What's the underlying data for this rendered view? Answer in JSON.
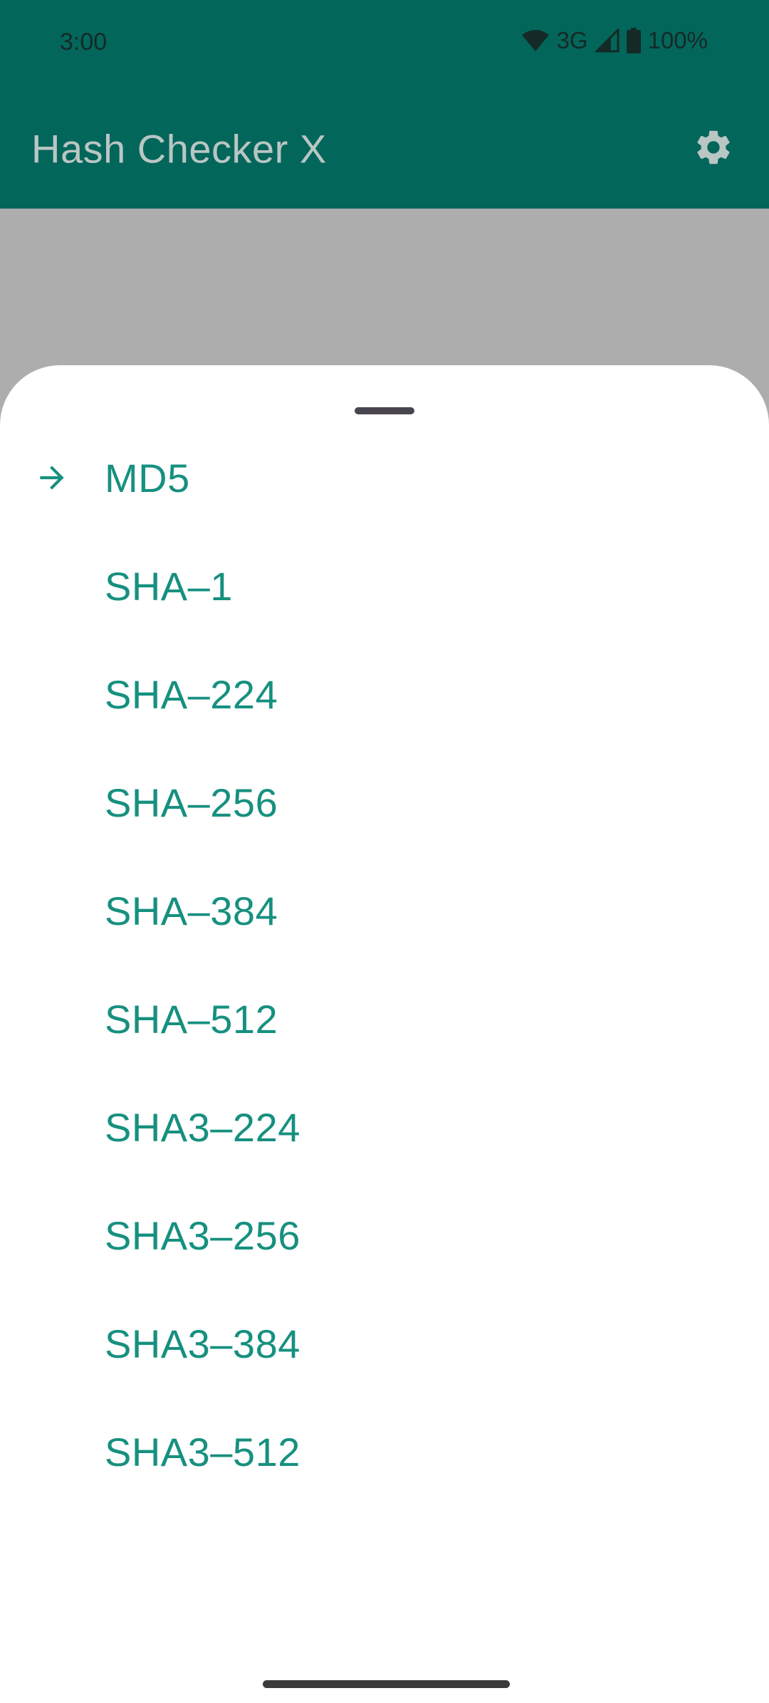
{
  "status_bar": {
    "time": "3:00",
    "network": "3G",
    "battery": "100%"
  },
  "app_bar": {
    "title": "Hash Checker X",
    "settings_icon": "gear-icon"
  },
  "sheet": {
    "selected_index": 0,
    "selected_icon": "arrow-right-icon",
    "items": [
      {
        "label": "MD5"
      },
      {
        "label": "SHA–1"
      },
      {
        "label": "SHA–224"
      },
      {
        "label": "SHA–256"
      },
      {
        "label": "SHA–384"
      },
      {
        "label": "SHA–512"
      },
      {
        "label": "SHA3–224"
      },
      {
        "label": "SHA3–256"
      },
      {
        "label": "SHA3–384"
      },
      {
        "label": "SHA3–512"
      }
    ]
  },
  "colors": {
    "app_bar": "#03665b",
    "accent_text": "#16907f",
    "scrim": "#adadad",
    "title_text": "#b9c6c3"
  }
}
